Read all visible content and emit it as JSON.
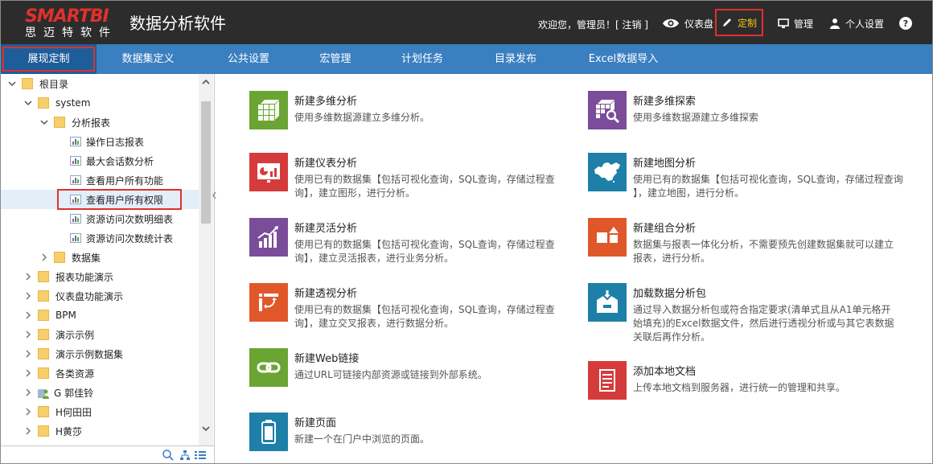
{
  "header": {
    "logo_main": "SMARTBI",
    "logo_sub": "思迈特软件",
    "title": "数据分析软件",
    "welcome": "欢迎您，管理员！[ 注销 ]",
    "dashboard": "仪表盘",
    "customize": "定制",
    "manage": "管理",
    "personal": "个人设置",
    "help": "?"
  },
  "nav": {
    "tabs": [
      "展现定制",
      "数据集定义",
      "公共设置",
      "宏管理",
      "计划任务",
      "目录发布",
      "Excel数据导入"
    ],
    "active": "展现定制"
  },
  "tree": [
    {
      "label": "根目录",
      "type": "folder",
      "expanded": true
    },
    {
      "label": "system",
      "type": "folder",
      "expanded": true
    },
    {
      "label": "分析报表",
      "type": "folder",
      "expanded": true
    },
    {
      "label": "操作日志报表",
      "type": "report"
    },
    {
      "label": "最大会话数分析",
      "type": "report"
    },
    {
      "label": "查看用户所有功能",
      "type": "report"
    },
    {
      "label": "查看用户所有权限",
      "type": "report",
      "selected": true
    },
    {
      "label": "资源访问次数明细表",
      "type": "report"
    },
    {
      "label": "资源访问次数统计表",
      "type": "report"
    },
    {
      "label": "数据集",
      "type": "folder"
    },
    {
      "label": "报表功能演示",
      "type": "folder"
    },
    {
      "label": "仪表盘功能演示",
      "type": "folder"
    },
    {
      "label": "BPM",
      "type": "folder"
    },
    {
      "label": "演示示例",
      "type": "folder"
    },
    {
      "label": "演示示例数据集",
      "type": "folder"
    },
    {
      "label": "各类资源",
      "type": "folder"
    },
    {
      "label": "G 郭佳铃",
      "type": "user"
    },
    {
      "label": "H何田田",
      "type": "folder"
    },
    {
      "label": "H黄莎",
      "type": "folder"
    }
  ],
  "cards": [
    {
      "title": "新建多维分析",
      "desc": [
        "使用多维数据源建立多维分析。"
      ],
      "color": "#6aa533",
      "icon": "cube-icon"
    },
    {
      "title": "新建多维探索",
      "desc": [
        "使用多维数据源建立多维探索"
      ],
      "color": "#7a4c9a",
      "icon": "cube-search-icon"
    },
    {
      "title": "新建仪表分析",
      "desc": [
        "使用已有的数据集【包括可视化查询，SQL查询，存储过程查",
        "询】，建立图形，进行分析。"
      ],
      "color": "#d53b3b",
      "icon": "dashboard-chart-icon"
    },
    {
      "title": "新建地图分析",
      "desc": [
        "使用已有的数据集【包括可视化查询，SQL查询，存储过程查询",
        "】，建立地图，进行分析。"
      ],
      "color": "#1e7fa8",
      "icon": "china-map-icon"
    },
    {
      "title": "新建灵活分析",
      "desc": [
        "使用已有的数据集【包括可视化查询，SQL查询，存储过程查",
        "询】，建立灵活报表，进行业务分析。"
      ],
      "color": "#7a4c9a",
      "icon": "growth-chart-icon"
    },
    {
      "title": "新建组合分析",
      "desc": [
        "数据集与报表一体化分析，不需要预先创建数据集就可以建立",
        "报表，进行分析。"
      ],
      "color": "#e0582a",
      "icon": "shapes-icon"
    },
    {
      "title": "新建透视分析",
      "desc": [
        "使用已有的数据集【包括可视化查询，SQL查询，存储过程查",
        "询】，建立交叉报表，进行数据分析。"
      ],
      "color": "#e0582a",
      "icon": "pivot-icon"
    },
    {
      "title": "加载数据分析包",
      "desc": [
        "通过导入数据分析包或符合指定要求(清单式且从A1单元格开",
        "始填充)的Excel数据文件，然后进行透视分析或与其它表数据",
        "关联后再作分析。"
      ],
      "color": "#1e7fa8",
      "icon": "package-load-icon"
    },
    {
      "title": "新建Web链接",
      "desc": [
        "通过URL可链接内部资源或链接到外部系统。"
      ],
      "color": "#6aa533",
      "icon": "link-icon"
    },
    {
      "title": "添加本地文档",
      "desc": [
        "上传本地文档到服务器，进行统一的管理和共享。"
      ],
      "color": "#d53b3b",
      "icon": "document-icon"
    },
    {
      "title": "新建页面",
      "desc": [
        "新建一个在门户中浏览的页面。"
      ],
      "color": "#1e7fa8",
      "icon": "page-icon"
    }
  ]
}
